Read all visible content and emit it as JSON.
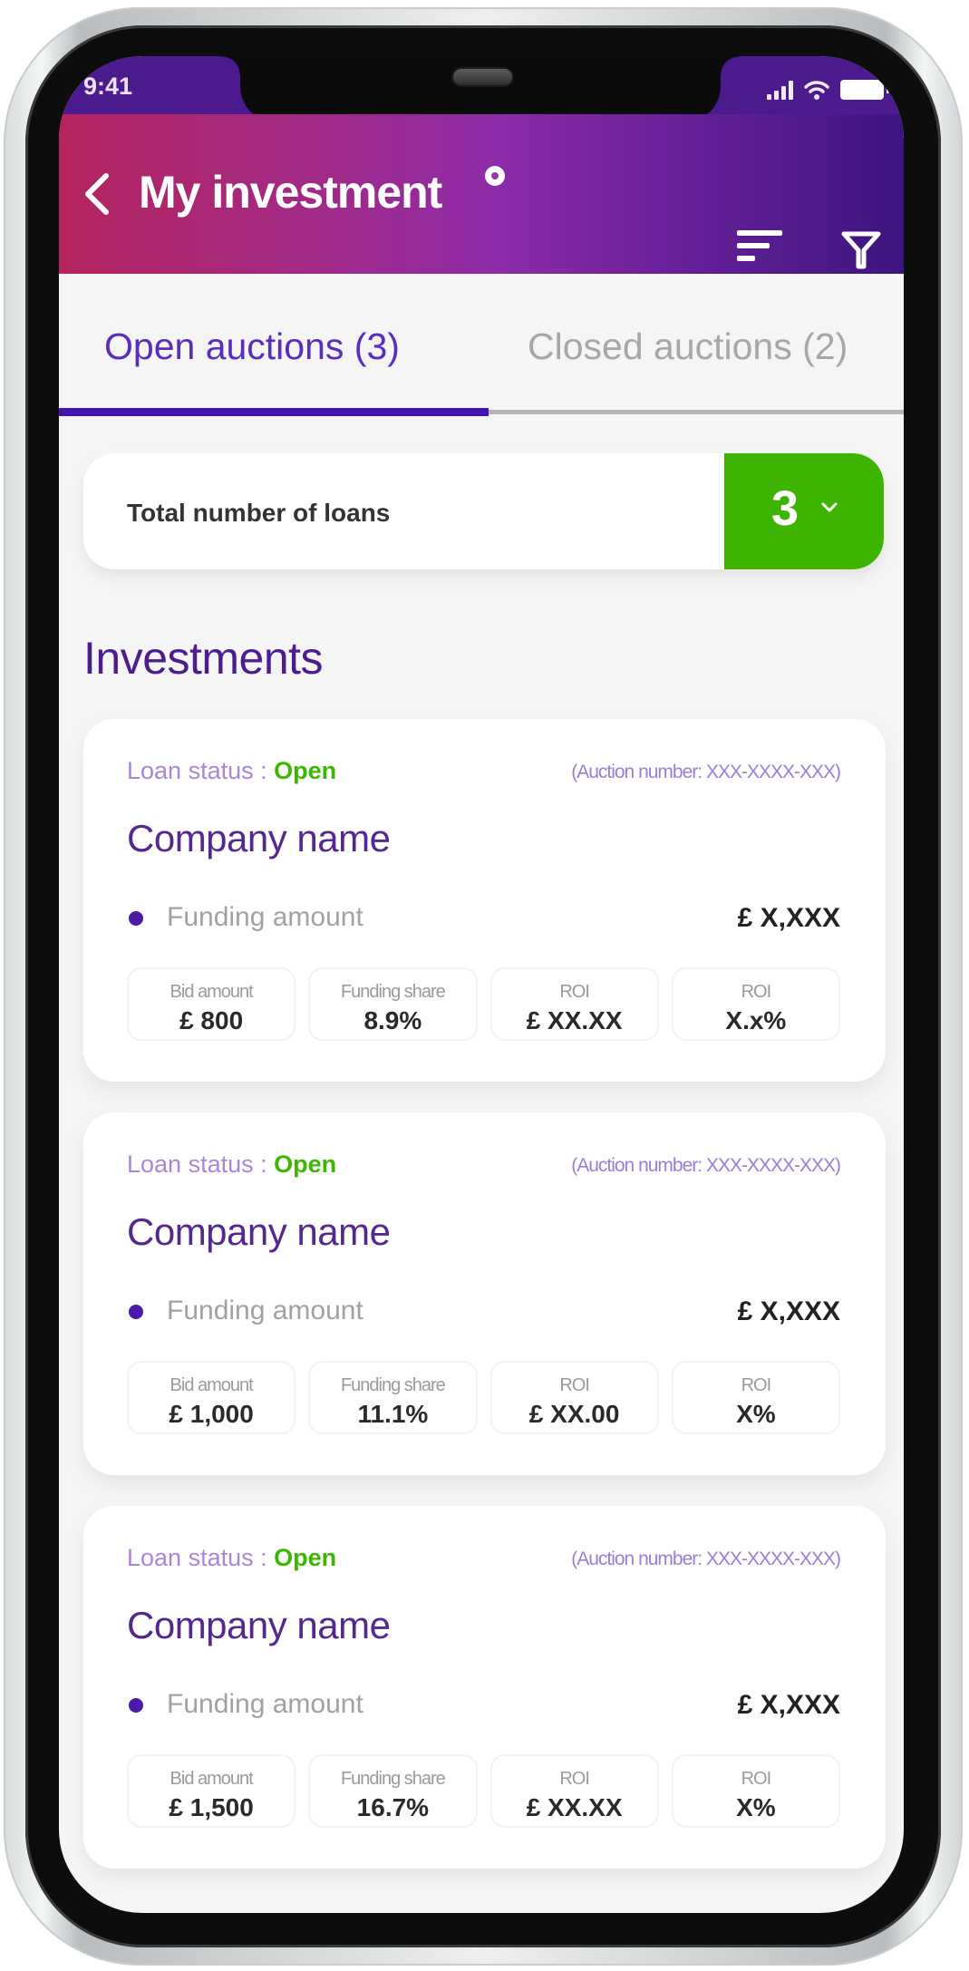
{
  "status_bar": {
    "time": "9:41",
    "icons": [
      "signal-icon",
      "wifi-icon",
      "battery-icon"
    ]
  },
  "header": {
    "title": "My investment",
    "back_icon": "chevron-left-icon",
    "info_icon": "info-icon",
    "sort_icon": "sort-icon",
    "filter_icon": "filter-icon",
    "colors": {
      "gradient_start": "#b4245e",
      "gradient_mid": "#8d2ba8",
      "gradient_end": "#3c1580"
    }
  },
  "tabs": [
    {
      "label": "Open auctions (3)",
      "active": true
    },
    {
      "label": "Closed auctions (2)",
      "active": false
    }
  ],
  "loans_summary": {
    "label": "Total number of loans",
    "count": "3",
    "dropdown_icon": "chevron-down-icon",
    "accent_color": "#3db400"
  },
  "section_title": "Investments",
  "investments": [
    {
      "status_label": "Loan status : ",
      "status_value": "Open",
      "auction_number": "(Auction number: XXX-XXXX-XXX)",
      "company": "Company name",
      "funding_label": "Funding amount",
      "funding_value": "£ X,XXX",
      "stats": [
        {
          "label": "Bid amount",
          "value": "£ 800"
        },
        {
          "label": "Funding share",
          "value": "8.9%"
        },
        {
          "label": "ROI",
          "value": "£ XX.XX"
        },
        {
          "label": "ROI",
          "value": "X.x%"
        }
      ]
    },
    {
      "status_label": "Loan status : ",
      "status_value": "Open",
      "auction_number": "(Auction number: XXX-XXXX-XXX)",
      "company": "Company name",
      "funding_label": "Funding amount",
      "funding_value": "£ X,XXX",
      "stats": [
        {
          "label": "Bid amount",
          "value": "£ 1,000"
        },
        {
          "label": "Funding share",
          "value": "11.1%"
        },
        {
          "label": "ROI",
          "value": "£ XX.00"
        },
        {
          "label": "ROI",
          "value": "X%"
        }
      ]
    },
    {
      "status_label": "Loan status : ",
      "status_value": "Open",
      "auction_number": "(Auction number: XXX-XXXX-XXX)",
      "company": "Company name",
      "funding_label": "Funding amount",
      "funding_value": "£ X,XXX",
      "stats": [
        {
          "label": "Bid amount",
          "value": "£ 1,500"
        },
        {
          "label": "Funding share",
          "value": "16.7%"
        },
        {
          "label": "ROI",
          "value": "£ XX.XX"
        },
        {
          "label": "ROI",
          "value": "X%"
        }
      ]
    }
  ]
}
